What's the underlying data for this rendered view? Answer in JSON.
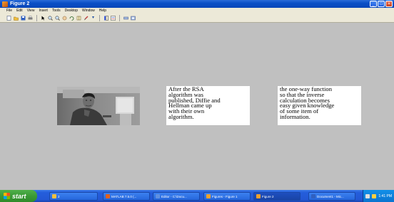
{
  "window": {
    "title": "Figure 2"
  },
  "menu": [
    "File",
    "Edit",
    "View",
    "Insert",
    "Tools",
    "Desktop",
    "Window",
    "Help"
  ],
  "toolbar": {
    "icons": [
      "new-file-icon",
      "open-file-icon",
      "save-icon",
      "print-icon",
      "select-arrow-icon",
      "zoom-in-icon",
      "zoom-out-icon",
      "pan-icon",
      "rotate-3d-icon",
      "data-cursor-icon",
      "brush-icon",
      "link-icon",
      "insert-colorbar-icon",
      "insert-legend-icon",
      "hide-plot-tools-icon",
      "show-plot-tools-icon"
    ]
  },
  "figure": {
    "text_box_1": "After the RSA\nalgorithm was\npublished, Diffie and\nHellman came up\nwith their own\nalgorithm.",
    "text_box_2": "the one-way function\nso that the inverse\ncalculation becomes\neasy given knowledge\nof some item of\ninformation."
  },
  "taskbar": {
    "start_label": "start",
    "tasks": [
      {
        "label": "2",
        "icon_color": "#f0c040"
      },
      {
        "label": "MATLAB 7.5.0 (...",
        "icon_color": "#e06020"
      },
      {
        "label": "Editor - C:\\Docu...",
        "icon_color": "#6090e0"
      },
      {
        "label": "Figures - Figure 1",
        "icon_color": "#f0a030"
      },
      {
        "label": "Figure 2",
        "icon_color": "#f0a030"
      },
      {
        "label": "Document1 - Mic...",
        "icon_color": "#3060c0"
      }
    ],
    "clock": "1:41 PM"
  }
}
